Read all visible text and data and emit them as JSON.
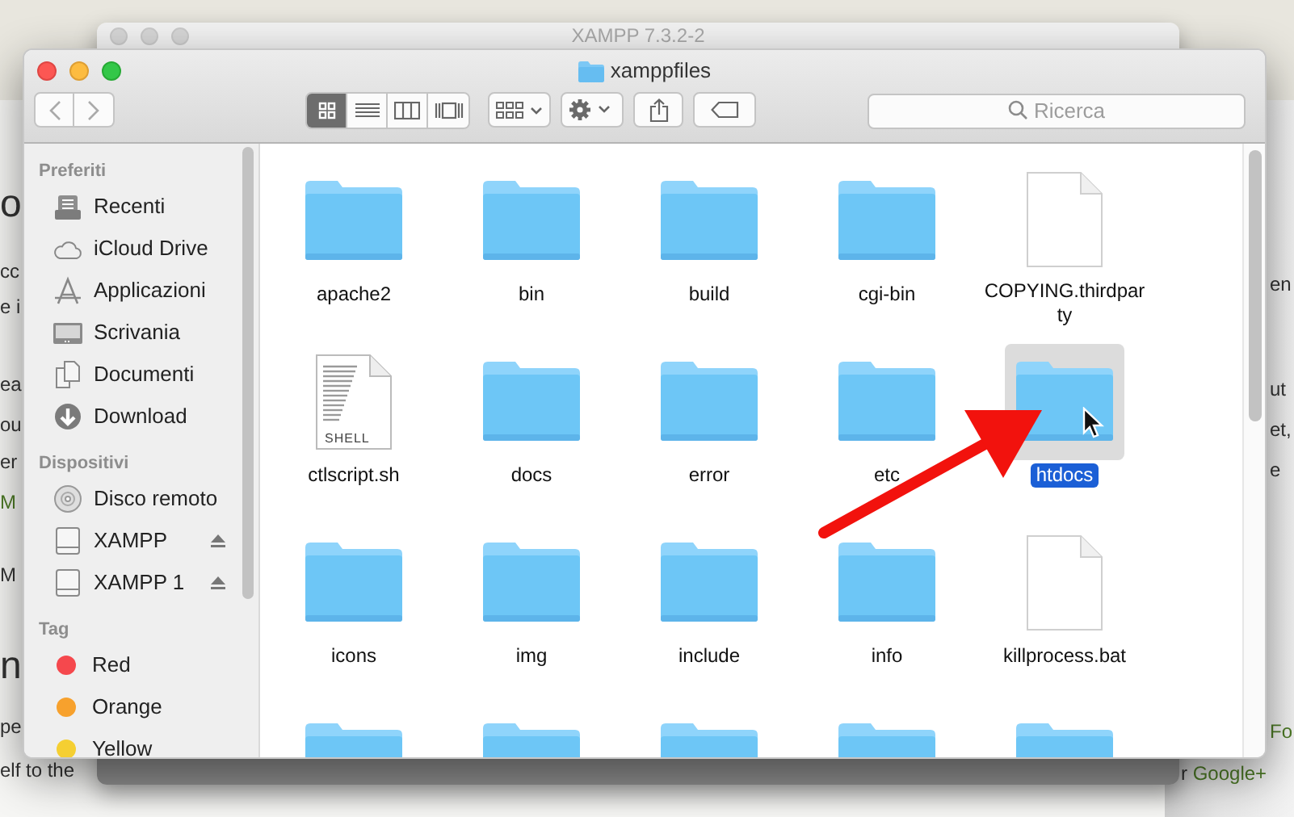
{
  "background_page": {
    "left": [
      {
        "kind": "heading",
        "parts": [
          {
            "text": "o",
            "kind": "text"
          }
        ]
      },
      {
        "kind": "paragraph",
        "parts": [
          {
            "text": "cc",
            "kind": "text"
          }
        ]
      },
      {
        "kind": "paragraph",
        "parts": [
          {
            "text": "e i",
            "kind": "text"
          }
        ]
      },
      {
        "kind": "paragraph",
        "parts": [
          {
            "text": "ea",
            "kind": "text"
          }
        ]
      },
      {
        "kind": "paragraph",
        "parts": [
          {
            "text": "ou",
            "kind": "text"
          }
        ]
      },
      {
        "kind": "paragraph",
        "parts": [
          {
            "text": "er",
            "kind": "text"
          }
        ]
      },
      {
        "kind": "paragraph",
        "parts": [
          {
            "text": "M",
            "kind": "link"
          }
        ]
      },
      {
        "kind": "paragraph",
        "parts": [
          {
            "text": "M",
            "kind": "text"
          }
        ]
      },
      {
        "kind": "heading",
        "parts": [
          {
            "text": "n",
            "kind": "text"
          }
        ]
      },
      {
        "kind": "paragraph",
        "parts": [
          {
            "text": "pe",
            "kind": "text"
          }
        ]
      },
      {
        "kind": "paragraph",
        "parts": [
          {
            "text": "elf to the",
            "kind": "text"
          }
        ]
      }
    ],
    "right": [
      {
        "parts": [
          {
            "text": "en",
            "kind": "text"
          }
        ]
      },
      {
        "parts": [
          {
            "text": "ut",
            "kind": "text"
          }
        ]
      },
      {
        "parts": [
          {
            "text": "et,",
            "kind": "text"
          }
        ]
      },
      {
        "parts": [
          {
            "text": "e",
            "kind": "text"
          }
        ]
      },
      {
        "parts": [
          {
            "text": "Fo",
            "kind": "link"
          }
        ]
      },
      {
        "parts": [
          {
            "text": "r ",
            "kind": "text"
          },
          {
            "text": "Google+",
            "kind": "link"
          }
        ]
      }
    ]
  },
  "back_window": {
    "title": "XAMPP 7.3.2-2"
  },
  "finder": {
    "title": "xamppfiles",
    "views": [
      {
        "kind": "icons",
        "selected": true
      },
      {
        "kind": "list",
        "selected": false
      },
      {
        "kind": "columns",
        "selected": false
      },
      {
        "kind": "gallery",
        "selected": false
      }
    ],
    "search": {
      "placeholder": "Ricerca"
    },
    "sidebar": [
      {
        "heading": "Preferiti",
        "items": [
          {
            "label": "Recenti",
            "kind": "recents"
          },
          {
            "label": "iCloud Drive",
            "kind": "cloud"
          },
          {
            "label": "Applicazioni",
            "kind": "apps"
          },
          {
            "label": "Scrivania",
            "kind": "desktop"
          },
          {
            "label": "Documenti",
            "kind": "documents"
          },
          {
            "label": "Download",
            "kind": "download"
          }
        ]
      },
      {
        "heading": "Dispositivi",
        "items": [
          {
            "label": "Disco remoto",
            "kind": "disc"
          },
          {
            "label": "XAMPP",
            "kind": "drive",
            "ejectable": true
          },
          {
            "label": "XAMPP 1",
            "kind": "drive",
            "ejectable": true
          }
        ]
      },
      {
        "heading": "Tag",
        "items": [
          {
            "label": "Red",
            "kind": "tag",
            "color": "#f5484d"
          },
          {
            "label": "Orange",
            "kind": "tag",
            "color": "#f7a12d"
          },
          {
            "label": "Yellow",
            "kind": "tag",
            "color": "#f5cf32"
          }
        ]
      }
    ],
    "files": [
      {
        "name": "apache2",
        "kind": "folder",
        "selected": false
      },
      {
        "name": "bin",
        "kind": "folder",
        "selected": false
      },
      {
        "name": "build",
        "kind": "folder",
        "selected": false
      },
      {
        "name": "cgi-bin",
        "kind": "folder",
        "selected": false
      },
      {
        "name": "COPYING.thirdparty",
        "kind": "document",
        "selected": false
      },
      {
        "name": "ctlscript.sh",
        "kind": "shell",
        "badge": "SHELL",
        "selected": false
      },
      {
        "name": "docs",
        "kind": "folder",
        "selected": false
      },
      {
        "name": "error",
        "kind": "folder",
        "selected": false
      },
      {
        "name": "etc",
        "kind": "folder",
        "selected": false
      },
      {
        "name": "htdocs",
        "kind": "folder",
        "selected": true
      },
      {
        "name": "icons",
        "kind": "folder",
        "selected": false
      },
      {
        "name": "img",
        "kind": "folder",
        "selected": false
      },
      {
        "name": "include",
        "kind": "folder",
        "selected": false
      },
      {
        "name": "info",
        "kind": "folder",
        "selected": false
      },
      {
        "name": "killprocess.bat",
        "kind": "document",
        "selected": false
      },
      {
        "kind": "folder",
        "selected": false
      },
      {
        "kind": "folder",
        "selected": false
      },
      {
        "kind": "folder",
        "selected": false
      },
      {
        "kind": "folder",
        "selected": false
      },
      {
        "kind": "folder",
        "selected": false
      }
    ]
  }
}
